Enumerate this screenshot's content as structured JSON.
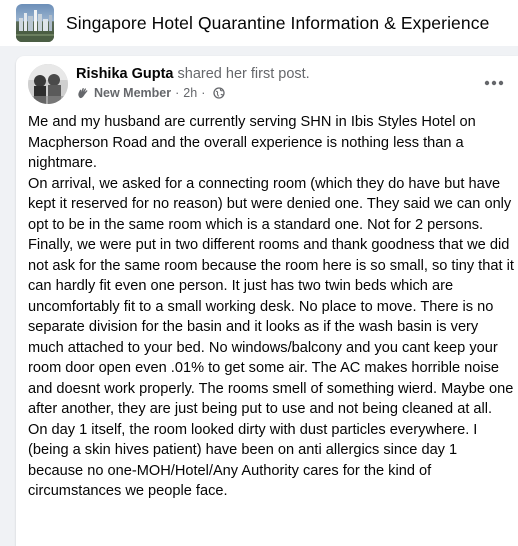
{
  "group": {
    "title": "Singapore Hotel Quarantine Information & Experience",
    "avatar_icon": "city-skyline-icon"
  },
  "post": {
    "author": "Rishika Gupta",
    "action": "shared her first post.",
    "badge_icon": "waving-hand-icon",
    "badge": "New Member",
    "time": "2h",
    "separator": "·",
    "privacy_icon": "globe-icon",
    "more_icon": "more-options-icon",
    "paragraphs": [
      "Me and my husband are currently serving SHN in Ibis Styles Hotel on Macpherson Road and the overall experience is nothing less than a nightmare.",
      "On arrival, we asked for a connecting room (which they do have but have kept it reserved for no reason) but were denied one. They said we can only opt to be in the same room which is a standard one. Not for 2 persons.",
      "Finally, we were put in two different rooms and thank goodness that we did not ask for the same room because the room here is so small, so tiny that it can hardly fit even one person. It just has two twin beds which are uncomfortably fit to a small working desk. No place to move. There is no separate division for the basin and it looks as if the wash basin is very much attached to your bed. No windows/balcony and you cant keep your room door open even .01% to get some air. The AC makes horrible noise and doesnt work properly. The rooms smell of something wierd. Maybe one after another, they are just being put to use and not being cleaned at all. On day 1 itself, the room looked dirty with dust particles everywhere. I (being a skin hives patient) have been on anti allergics since day 1 because no one-MOH/Hotel/Any Authority cares for the kind of circumstances we people face."
    ]
  }
}
